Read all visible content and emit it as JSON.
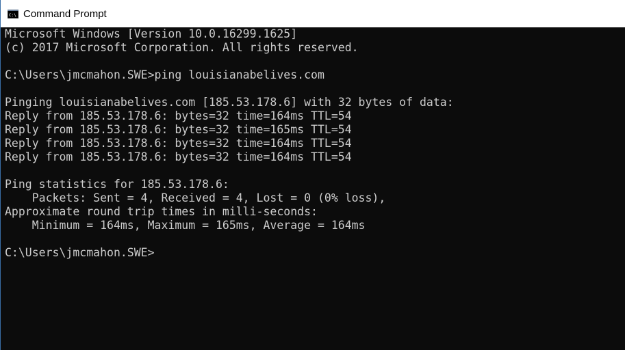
{
  "window": {
    "title": "Command Prompt",
    "icon": "cmd-icon"
  },
  "colors": {
    "console_background": "#0c0c0c",
    "console_text": "#cccccc",
    "titlebar_background": "#ffffff"
  },
  "console": {
    "lines": [
      "Microsoft Windows [Version 10.0.16299.1625]",
      "(c) 2017 Microsoft Corporation. All rights reserved.",
      "C:\\Users\\jmcmahon.SWE>ping louisianabelives.com",
      "Pinging louisianabelives.com [185.53.178.6] with 32 bytes of data:",
      "Reply from 185.53.178.6: bytes=32 time=164ms TTL=54",
      "Reply from 185.53.178.6: bytes=32 time=165ms TTL=54",
      "Reply from 185.53.178.6: bytes=32 time=164ms TTL=54",
      "Reply from 185.53.178.6: bytes=32 time=164ms TTL=54",
      "Ping statistics for 185.53.178.6:",
      "    Packets: Sent = 4, Received = 4, Lost = 0 (0% loss),",
      "Approximate round trip times in milli-seconds:",
      "    Minimum = 164ms, Maximum = 165ms, Average = 164ms",
      "C:\\Users\\jmcmahon.SWE>"
    ]
  }
}
